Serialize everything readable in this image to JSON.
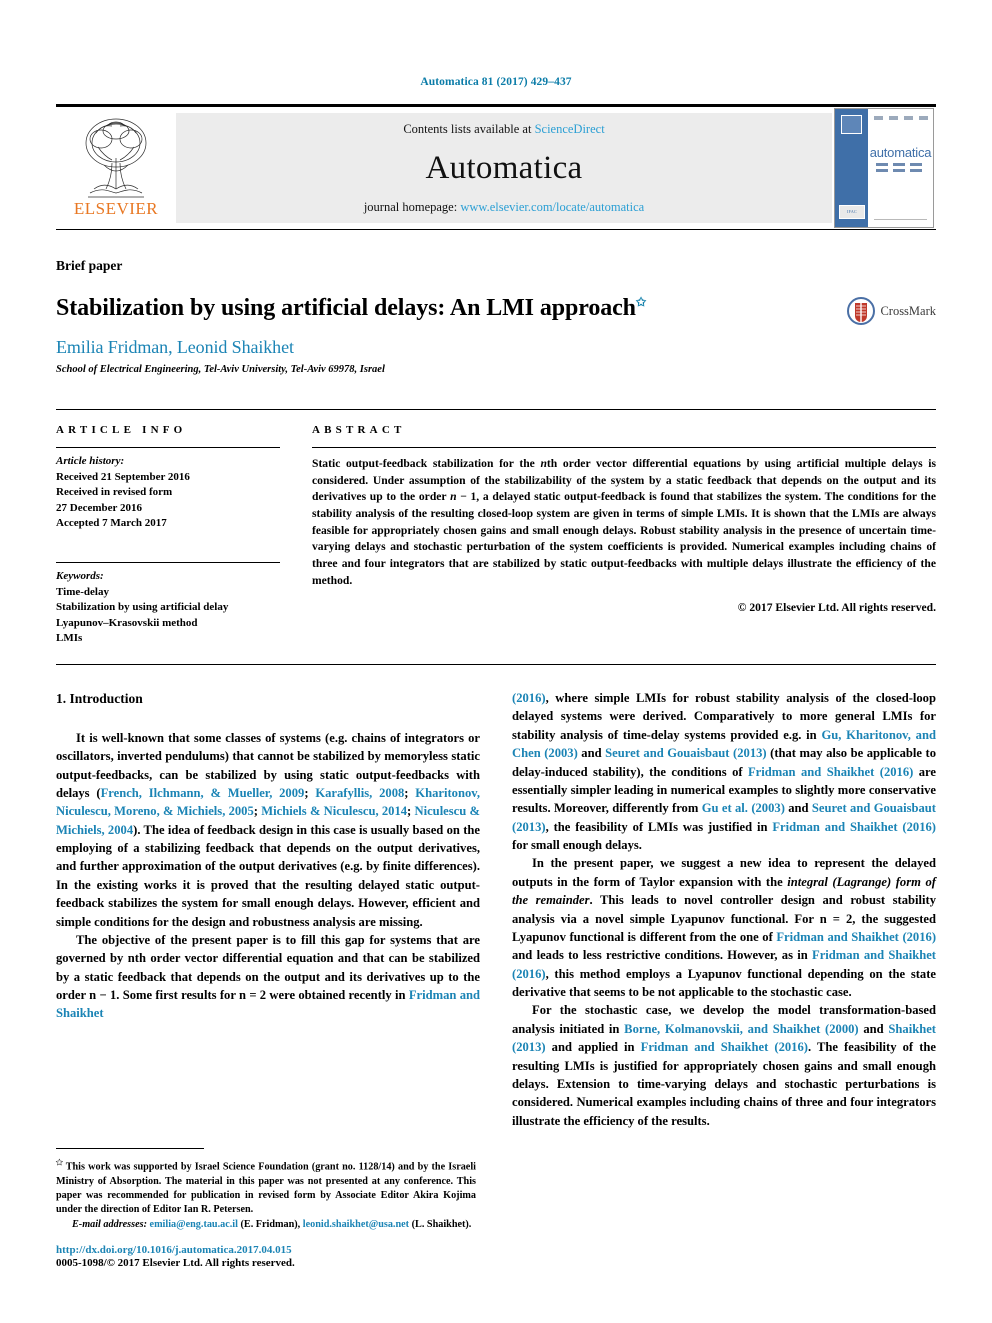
{
  "running_head": "Automatica 81 (2017) 429–437",
  "masthead": {
    "publisher_name": "ELSEVIER",
    "contents_prefix": "Contents lists available at ",
    "contents_link": "ScienceDirect",
    "journal_title": "Automatica",
    "homepage_prefix": "journal homepage: ",
    "homepage_link": "www.elsevier.com/locate/automatica",
    "cover_word": "automatica",
    "cover_spine_badge": "IFAC"
  },
  "article_type": "Brief paper",
  "title": "Stabilization by using artificial delays: An LMI approach",
  "title_footnote_marker": "✩",
  "crossmark_label": "CrossMark",
  "authors": "Emilia Fridman, Leonid Shaikhet",
  "affiliation": "School of Electrical Engineering, Tel-Aviv University, Tel-Aviv 69978, Israel",
  "article_info": {
    "label": "ARTICLE INFO",
    "history_head": "Article history:",
    "history_lines": [
      "Received 21 September 2016",
      "Received in revised form",
      "27 December 2016",
      "Accepted 7 March 2017"
    ],
    "keywords_head": "Keywords:",
    "keywords": [
      "Time-delay",
      "Stabilization by using artificial delay",
      "Lyapunov–Krasovskii method",
      "LMIs"
    ]
  },
  "abstract": {
    "label": "ABSTRACT",
    "part1": "Static output-feedback stabilization for the ",
    "italic1": "n",
    "part2": "th order vector differential equations by using artificial multiple delays is considered. Under assumption of the stabilizability of the system by a static feedback that depends on the output and its derivatives up to the order ",
    "italic2": "n",
    "part3": " − 1, a delayed static output-feedback is found that stabilizes the system. The conditions for the stability analysis of the resulting closed-loop system are given in terms of simple LMIs. It is shown that the LMIs are always feasible for appropriately chosen gains and small enough delays. Robust stability analysis in the presence of uncertain time-varying delays and stochastic perturbation of the system coefficients is provided. Numerical examples including chains of three and four integrators that are stabilized by static output-feedbacks with multiple delays illustrate the efficiency of the method.",
    "copyright": "© 2017 Elsevier Ltd. All rights reserved."
  },
  "introduction": {
    "heading": "1. Introduction",
    "p1_a": "It is well-known that some classes of systems (e.g. chains of integrators or oscillators, inverted pendulums) that cannot be stabilized by memoryless static output-feedbacks, can be stabilized by using static output-feedbacks with delays (",
    "p1_cites": [
      "French, Ilchmann, & Mueller, 2009",
      "Karafyllis, 2008",
      "Kharitonov, Niculescu, Moreno, & Michiels, 2005",
      "Michiels & Niculescu, 2014",
      "Niculescu & Michiels, 2004"
    ],
    "p1_b": "). The idea of feedback design in this case is usually based on the employing of a stabilizing feedback that depends on the output derivatives, and further approximation of the output derivatives (e.g. by finite differences). In the existing works it is proved that the resulting delayed static output-feedback stabilizes the system for small enough delays. However, efficient and simple conditions for the design and robustness analysis are missing.",
    "p2_a": "The objective of the present paper is to fill this gap for systems that are governed by nth order vector differential equation and that can be stabilized by a static feedback that depends on the output and its derivatives up to the order n − 1. Some first results for n = 2 were obtained recently in ",
    "p2_cite": "Fridman and Shaikhet",
    "p2_year": "(2016)",
    "p2_b": ", where simple LMIs for robust stability analysis of the closed-loop delayed systems were derived. Comparatively to more general LMIs for stability analysis of time-delay systems provided e.g. in ",
    "p2_cite2": "Gu, Kharitonov, and Chen",
    "p2_year2": "(2003)",
    "p2_c": " and ",
    "p2_cite3": "Seuret and Gouaisbaut",
    "p2_year3": "(2013)",
    "p2_d": " (that may also be applicable to delay-induced stability), the conditions of ",
    "p2_cite4": "Fridman and Shaikhet",
    "p2_year4": "(2016)",
    "p2_e": " are essentially simpler leading in numerical examples to slightly more conservative results. Moreover, differently from ",
    "p2_cite5": "Gu et al.",
    "p2_year5": "(2003)",
    "p2_f": " and ",
    "p2_cite6": "Seuret and Gouaisbaut",
    "p2_year6": "(2013)",
    "p2_g": ", the feasibility of LMIs was justified in ",
    "p2_cite7": "Fridman and Shaikhet",
    "p2_year7": "(2016)",
    "p2_h": " for small enough delays.",
    "p3_a": "In the present paper, we suggest a new idea to represent the delayed outputs in the form of Taylor expansion with the ",
    "p3_italic": "integral (Lagrange) form of the remainder",
    "p3_b": ". This leads to novel controller design and robust stability analysis via a novel simple Lyapunov functional. For n = 2, the suggested Lyapunov functional is different from the one of ",
    "p3_cite1": "Fridman and Shaikhet",
    "p3_year1": "(2016)",
    "p3_c": " and leads to less restrictive conditions. However, as in ",
    "p3_cite2": "Fridman and Shaikhet",
    "p3_year2": "(2016)",
    "p3_d": ", this method employs a Lyapunov functional depending on the state derivative that seems to be not applicable to the stochastic case.",
    "p4_a": "For the stochastic case, we develop the model transformation-based analysis initiated in ",
    "p4_cite1": "Borne, Kolmanovskii, and Shaikhet",
    "p4_year1": "(2000)",
    "p4_b": " and ",
    "p4_cite2": "Shaikhet",
    "p4_year2": "(2013)",
    "p4_c": " and applied in ",
    "p4_cite3": "Fridman and Shaikhet",
    "p4_year3": "(2016)",
    "p4_d": ". The feasibility of the resulting LMIs is justified for appropriately chosen gains and small enough delays. Extension to time-varying delays and stochastic perturbations is considered. Numerical examples including chains of three and four integrators illustrate the efficiency of the results."
  },
  "footnote": {
    "marker": "✩",
    "text": " This work was supported by Israel Science Foundation (grant no. 1128/14) and by the Israeli Ministry of Absorption. The material in this paper was not presented at any conference. This paper was recommended for publication in revised form by Associate Editor Akira Kojima under the direction of Editor Ian R. Petersen.",
    "email_label": "E-mail addresses:",
    "email1": "emilia@eng.tau.ac.il",
    "email1_owner": " (E. Fridman), ",
    "email2": "leonid.shaikhet@usa.net",
    "email2_owner": " (L. Shaikhet).",
    "doi": "http://dx.doi.org/10.1016/j.automatica.2017.04.015",
    "issn": "0005-1098/© 2017 Elsevier Ltd. All rights reserved."
  },
  "colors": {
    "accent_blue": "#1b84b5",
    "link_blue": "#2b9fd4",
    "elsevier_orange": "#e87722",
    "header_blue": "#0b7ca8"
  }
}
